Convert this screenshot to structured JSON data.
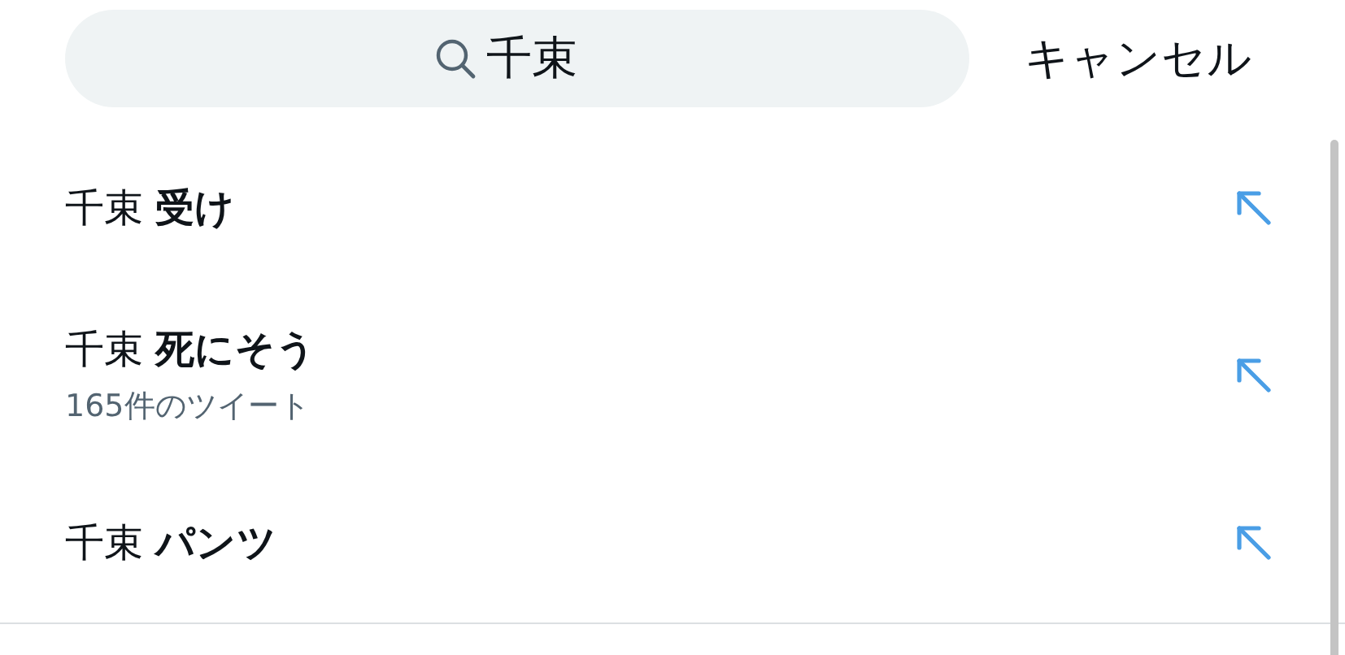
{
  "search": {
    "value": "千束"
  },
  "cancel": "キャンセル",
  "suggestions": [
    {
      "query": "千束 **受け**"
    },
    {
      "query": "千束 **死にそう**",
      "subtitle": "165件のツイート"
    },
    {
      "query": "千束 **パンツ**"
    }
  ]
}
